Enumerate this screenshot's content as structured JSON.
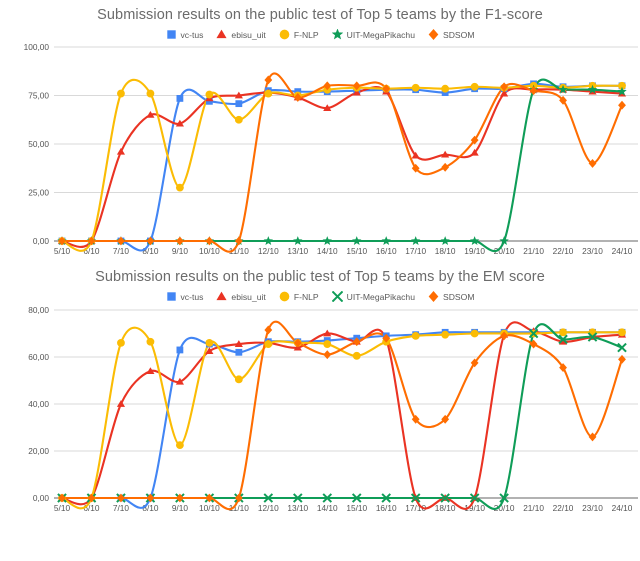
{
  "colors": {
    "vc_tus": "#4285f4",
    "ebisu_uit": "#ea3323",
    "f_nlp": "#fbbc04",
    "uit_megapikachu": "#0f9d58",
    "sdsom": "#ff6d01",
    "grid": "#d9d9d9",
    "axis": "#666666",
    "title": "#6b6b6b",
    "label": "#555555"
  },
  "charts": [
    {
      "id": "chart-top",
      "title": "Submission results on the public test of Top 5 teams by the F1-score",
      "legend": [
        {
          "label": "vc-tus",
          "marker": "square",
          "color_key": "vc_tus",
          "icon": "square-marker-icon"
        },
        {
          "label": "ebisu_uit",
          "marker": "triangle",
          "color_key": "ebisu_uit",
          "icon": "triangle-marker-icon"
        },
        {
          "label": "F-NLP",
          "marker": "circle",
          "color_key": "f_nlp",
          "icon": "circle-marker-icon"
        },
        {
          "label": "UIT-MegaPikachu",
          "marker": "star",
          "color_key": "uit_megapikachu",
          "icon": "star-marker-icon"
        },
        {
          "label": "SDSOM",
          "marker": "diamond",
          "color_key": "sdsom",
          "icon": "diamond-marker-icon"
        }
      ],
      "chart_data": {
        "type": "line",
        "title": "Submission results on the public test of Top 5 teams by the F1-score",
        "xlabel": "",
        "ylabel": "",
        "ylim": [
          0,
          100
        ],
        "yticks": [
          0,
          25,
          50,
          75,
          100
        ],
        "ytick_labels": [
          "0,00",
          "25,00",
          "50,00",
          "75,00",
          "100,00"
        ],
        "grid": true,
        "legend_position": "top",
        "categories": [
          "5/10",
          "6/10",
          "7/10",
          "8/10",
          "9/10",
          "10/10",
          "11/10",
          "12/10",
          "13/10",
          "14/10",
          "15/10",
          "16/10",
          "17/10",
          "18/10",
          "19/10",
          "20/10",
          "21/10",
          "22/10",
          "23/10",
          "24/10"
        ],
        "series": [
          {
            "name": "vc-tus",
            "marker": "square",
            "color_key": "vc_tus",
            "values": [
              0,
              0,
              0,
              0,
              73.5,
              72.0,
              70.8,
              77.5,
              77.0,
              77.0,
              77.5,
              78.0,
              78.0,
              76.5,
              78.5,
              78.5,
              81.0,
              79.5,
              80.0,
              80.0
            ]
          },
          {
            "name": "ebisu_uit",
            "marker": "triangle",
            "color_key": "ebisu_uit",
            "values": [
              0,
              0,
              46.0,
              65.0,
              60.5,
              73.5,
              75.0,
              76.5,
              74.0,
              68.5,
              76.5,
              77.0,
              44.0,
              44.5,
              45.5,
              76.0,
              78.0,
              78.0,
              77.0,
              76.0
            ]
          },
          {
            "name": "F-NLP",
            "marker": "circle",
            "color_key": "f_nlp",
            "values": [
              0,
              0,
              76.0,
              76.0,
              27.5,
              75.5,
              62.5,
              76.0,
              75.0,
              78.0,
              79.0,
              78.5,
              79.0,
              78.5,
              79.5,
              79.0,
              80.0,
              79.0,
              80.0,
              80.0
            ]
          },
          {
            "name": "UIT-MegaPikachu",
            "marker": "star",
            "color_key": "uit_megapikachu",
            "values": [
              0,
              0,
              0,
              0,
              0,
              0,
              0,
              0,
              0,
              0,
              0,
              0,
              0,
              0,
              0,
              0,
              78.0,
              78.0,
              78.0,
              77.0
            ]
          },
          {
            "name": "SDSOM",
            "marker": "diamond",
            "color_key": "sdsom",
            "values": [
              0,
              0,
              0,
              0,
              0,
              0,
              0,
              83.0,
              74.0,
              80.0,
              80.0,
              78.5,
              37.5,
              38.0,
              52.0,
              79.5,
              77.5,
              72.5,
              40.0,
              70.0
            ]
          }
        ]
      }
    },
    {
      "id": "chart-bottom",
      "title": "Submission results on the public test of Top 5 teams by the EM score",
      "legend": [
        {
          "label": "vc-tus",
          "marker": "square",
          "color_key": "vc_tus",
          "icon": "square-marker-icon"
        },
        {
          "label": "ebisu_uit",
          "marker": "triangle",
          "color_key": "ebisu_uit",
          "icon": "triangle-marker-icon"
        },
        {
          "label": "F-NLP",
          "marker": "circle",
          "color_key": "f_nlp",
          "icon": "circle-marker-icon"
        },
        {
          "label": "UIT-MegaPikachu",
          "marker": "cross",
          "color_key": "uit_megapikachu",
          "icon": "cross-marker-icon"
        },
        {
          "label": "SDSOM",
          "marker": "diamond",
          "color_key": "sdsom",
          "icon": "diamond-marker-icon"
        }
      ],
      "chart_data": {
        "type": "line",
        "title": "Submission results on the public test of Top 5 teams by the EM score",
        "xlabel": "",
        "ylabel": "",
        "ylim": [
          0,
          80
        ],
        "yticks": [
          0,
          20,
          40,
          60,
          80
        ],
        "ytick_labels": [
          "0,00",
          "20,00",
          "40,00",
          "60,00",
          "80,00"
        ],
        "grid": true,
        "legend_position": "top",
        "categories": [
          "5/10",
          "6/10",
          "7/10",
          "8/10",
          "9/10",
          "10/10",
          "11/10",
          "12/10",
          "13/10",
          "14/10",
          "15/10",
          "16/10",
          "17/10",
          "18/10",
          "19/10",
          "20/10",
          "21/10",
          "22/10",
          "23/10",
          "24/10"
        ],
        "series": [
          {
            "name": "vc-tus",
            "marker": "square",
            "color_key": "vc_tus",
            "values": [
              0,
              0,
              0,
              0,
              63.0,
              65.5,
              62.0,
              66.5,
              66.5,
              67.0,
              68.0,
              69.0,
              69.5,
              70.5,
              70.5,
              70.5,
              70.5,
              70.5,
              70.5,
              70.5
            ]
          },
          {
            "name": "ebisu_uit",
            "marker": "triangle",
            "color_key": "ebisu_uit",
            "values": [
              0,
              0,
              40.0,
              54.0,
              49.5,
              62.5,
              65.5,
              66.0,
              64.0,
              70.0,
              66.5,
              67.5,
              0,
              0,
              0,
              69.5,
              71.0,
              66.5,
              68.5,
              69.5
            ]
          },
          {
            "name": "F-NLP",
            "marker": "circle",
            "color_key": "f_nlp",
            "values": [
              0,
              0,
              66.0,
              66.5,
              22.5,
              66.0,
              50.5,
              65.5,
              66.0,
              65.5,
              60.5,
              66.5,
              69.0,
              69.5,
              70.0,
              70.0,
              70.0,
              70.5,
              70.5,
              70.5
            ]
          },
          {
            "name": "UIT-MegaPikachu",
            "marker": "cross",
            "color_key": "uit_megapikachu",
            "values": [
              0,
              0,
              0,
              0,
              0,
              0,
              0,
              0,
              0,
              0,
              0,
              0,
              0,
              0,
              0,
              0,
              70.0,
              67.5,
              68.5,
              64.0
            ]
          },
          {
            "name": "SDSOM",
            "marker": "diamond",
            "color_key": "sdsom",
            "values": [
              0,
              0,
              0,
              0,
              0,
              0,
              0,
              71.5,
              66.0,
              61.0,
              66.5,
              68.0,
              33.5,
              33.5,
              57.5,
              69.0,
              65.5,
              55.5,
              26.0,
              59.0
            ]
          }
        ]
      }
    }
  ]
}
